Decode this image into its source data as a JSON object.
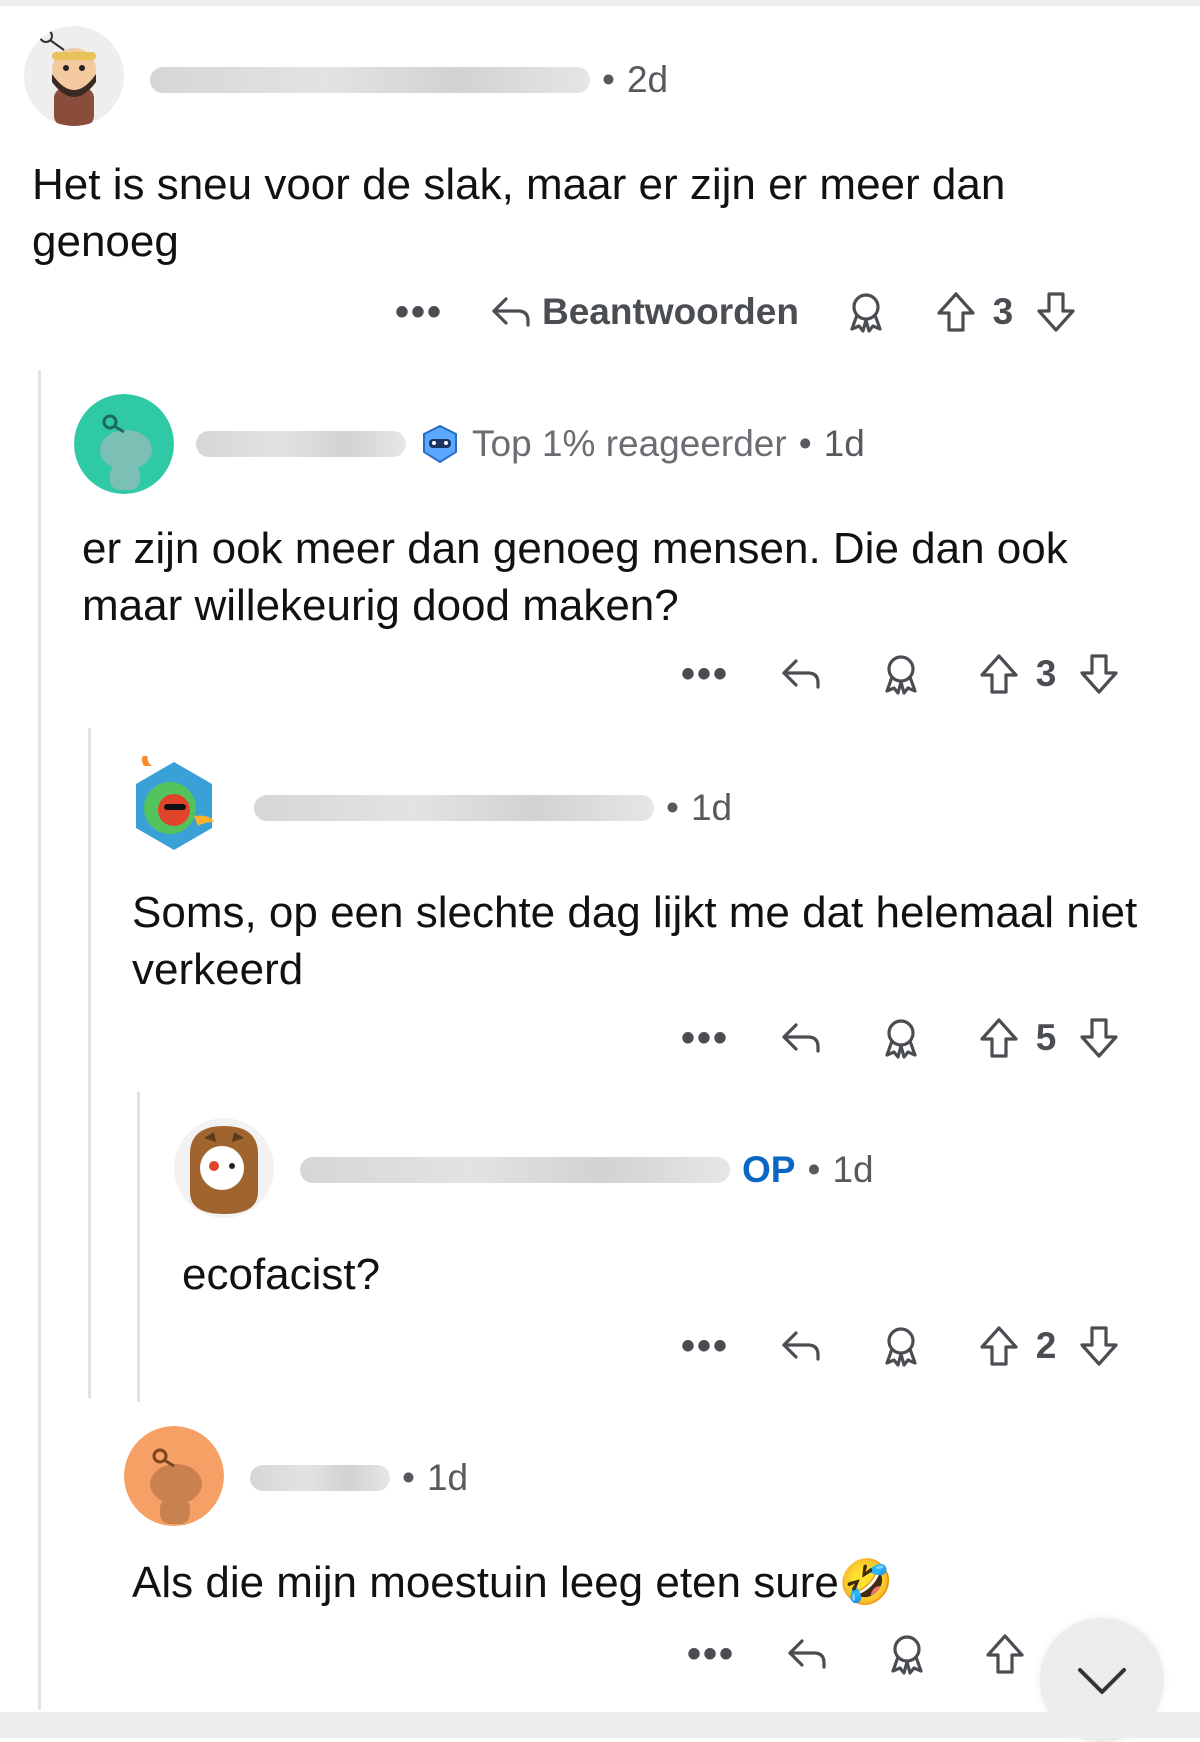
{
  "comments": [
    {
      "time": "2d",
      "body": "Het is sneu voor de slak, maar er zijn er meer dan genoeg",
      "reply_label": "Beantwoorden",
      "score": "3",
      "avatar_icon": "bearded-man-avatar"
    },
    {
      "flair": "Top 1% reageerder",
      "time": "1d",
      "body": "er zijn ook meer dan genoeg mensen. Die dan ook maar willekeurig dood maken?",
      "score": "3",
      "avatar_icon": "teal-snoo-avatar"
    },
    {
      "time": "1d",
      "body": "Soms, op een slechte dag lijkt me dat helemaal niet verkeerd",
      "score": "5",
      "avatar_icon": "fire-hexagon-avatar"
    },
    {
      "op_badge": "OP",
      "time": "1d",
      "body": "ecofacist?",
      "score": "2",
      "avatar_icon": "owl-costume-avatar"
    },
    {
      "time": "1d",
      "body": "Als die mijn moestuin leeg eten sure🤣",
      "avatar_icon": "orange-snoo-avatar"
    }
  ],
  "ui": {
    "more_label": "•••",
    "dot": "•"
  },
  "colors": {
    "op_blue": "#0a66c2",
    "thread_line": "#e2e2e2",
    "meta_gray": "#565a5e"
  }
}
